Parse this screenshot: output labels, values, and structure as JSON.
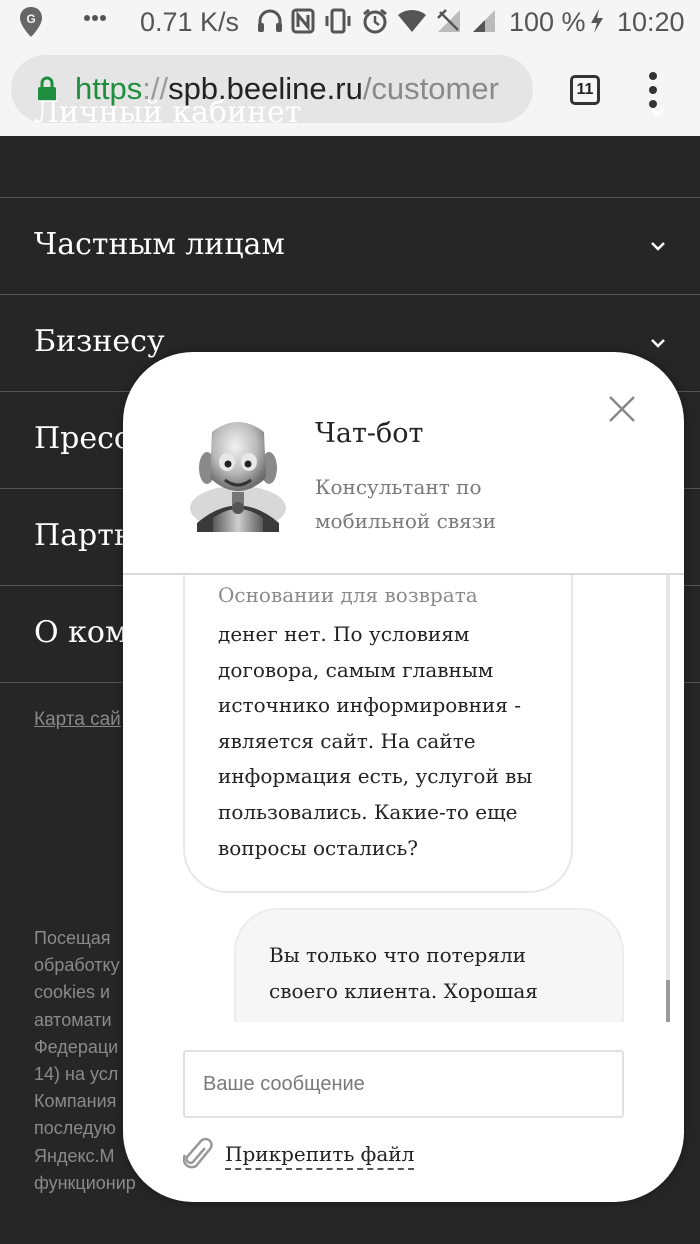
{
  "status_bar": {
    "network_speed": "0.71 K/s",
    "battery": "100 %",
    "time": "10:20",
    "icons": [
      "maps-notification-icon",
      "more-dots-icon",
      "headphones-icon",
      "nfc-icon",
      "vibrate-icon",
      "alarm-icon",
      "wifi-icon",
      "signal-off-icon",
      "signal-icon",
      "charging-icon"
    ]
  },
  "browser": {
    "url_scheme": "https",
    "url_separator": "://",
    "url_host": "spb.beeline.ru",
    "url_path": "/customer",
    "tab_count": "11"
  },
  "site_menu": {
    "items": [
      {
        "label": "Личный кабинет"
      },
      {
        "label": "Частным лицам"
      },
      {
        "label": "Бизнесу"
      },
      {
        "label": "Пресс"
      },
      {
        "label": "Партн"
      },
      {
        "label": "О ком"
      }
    ],
    "footer_link": "Карта сай",
    "footer_text": "Посещая\nобработку\ncookies и\nавтомати\nФедераци\n14) на усл\nКомпания\nпоследую\nЯндекс.М\nфункционир"
  },
  "chat": {
    "title": "Чат-бот",
    "subtitle": "Консультант по мобильной связи",
    "messages": [
      {
        "from": "bot",
        "faded_line": "Основании для возврата",
        "text": "денег нет. По условиям договора, самым главным источнико информировния - является сайт. На сайте информация есть, услугой вы пользовались. Какие-то еще вопросы остались?"
      },
      {
        "from": "user",
        "text": "Вы только что потеряли своего клиента. Хорошая"
      }
    ],
    "input_placeholder": "Ваше сообщение",
    "attach_label": "Прикрепить файл"
  },
  "colors": {
    "site_background": "#262626",
    "url_scheme_green": "#1e8e3e",
    "chat_background": "#ffffff"
  }
}
